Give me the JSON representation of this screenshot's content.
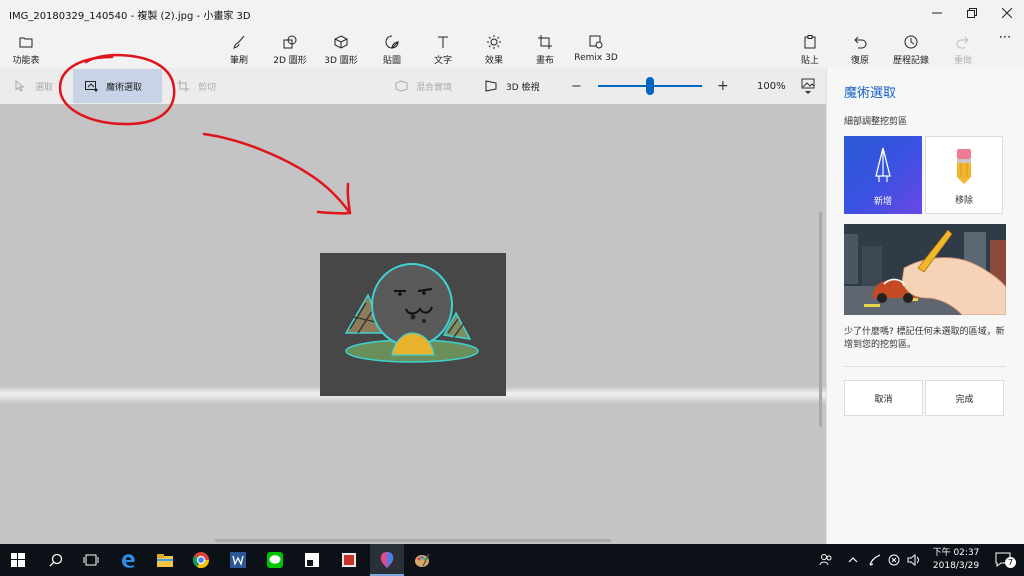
{
  "window": {
    "title": "IMG_20180329_140540 - 複製 (2).jpg - 小畫家 3D",
    "controls": [
      "minimize",
      "maximize",
      "close"
    ]
  },
  "toolbar": {
    "menu": "功能表",
    "brushes": "筆刷",
    "shapes2d": "2D 圖形",
    "shapes3d": "3D 圖形",
    "stickers": "貼圖",
    "text": "文字",
    "effects": "效果",
    "canvas": "畫布",
    "remix3d": "Remix 3D",
    "paste": "貼上",
    "undo": "復原",
    "history": "歷程記錄",
    "redo": "重做",
    "more": "⋯"
  },
  "subbar": {
    "select": "選取",
    "magic_select": "魔術選取",
    "crop": "剪切",
    "mixed_reality": "混合實境",
    "view3d": "3D 檢視",
    "zoom_minus": "−",
    "zoom_plus": "+",
    "zoom_level": "100%",
    "zoom_fraction": 0.5
  },
  "panel": {
    "title": "魔術選取",
    "subtitle": "細部調整挖剪區",
    "add_label": "新增",
    "remove_label": "移除",
    "description": "少了什麼嗎? 標記任何未選取的區域，新增到您的挖剪區。",
    "cancel": "取消",
    "done": "完成"
  },
  "taskbar": {
    "time": "下午 02:37",
    "date": "2018/3/29",
    "notification_count": "7",
    "apps": [
      "start-icon",
      "search-icon",
      "task-view-icon",
      "edge-icon",
      "file-explorer-icon",
      "chrome-icon",
      "word-icon",
      "line-icon",
      "sticky-app-icon",
      "cards-app-icon",
      "paint3d-icon",
      "paint-icon"
    ]
  },
  "colors": {
    "accent": "#0067c0",
    "panel_title": "#1464c8",
    "annotation": "#e0141b",
    "taskbar": "#0c1118",
    "canvas_bg": "#c4c4c4"
  }
}
